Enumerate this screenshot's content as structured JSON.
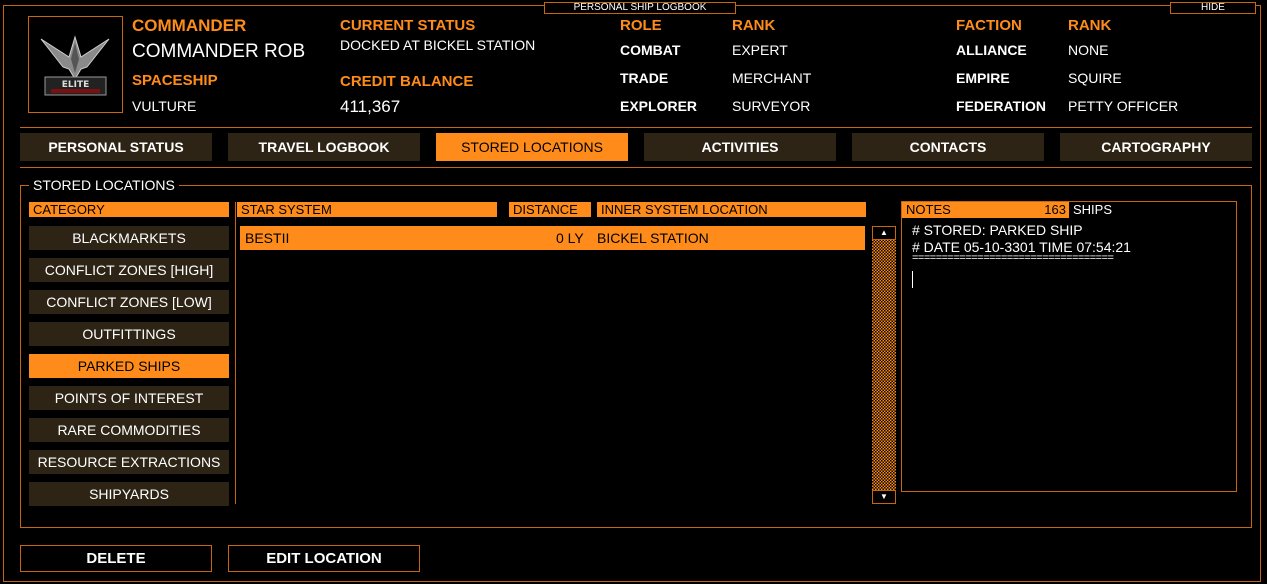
{
  "window": {
    "title": "PERSONAL SHIP LOGBOOK",
    "hide_label": "HIDE"
  },
  "commander": {
    "label": "COMMANDER",
    "name": "COMMANDER ROB",
    "ship_label": "SPACESHIP",
    "ship": "VULTURE",
    "status_label": "CURRENT STATUS",
    "status": "DOCKED AT BICKEL STATION",
    "credit_label": "CREDIT BALANCE",
    "credit": "411,367"
  },
  "roles": {
    "role_label": "ROLE",
    "rank_label": "RANK",
    "items": [
      {
        "role": "COMBAT",
        "rank": "EXPERT"
      },
      {
        "role": "TRADE",
        "rank": "MERCHANT"
      },
      {
        "role": "EXPLORER",
        "rank": "SURVEYOR"
      }
    ]
  },
  "factions": {
    "faction_label": "FACTION",
    "rank_label": "RANK",
    "items": [
      {
        "faction": "ALLIANCE",
        "rank": "NONE"
      },
      {
        "faction": "EMPIRE",
        "rank": "SQUIRE"
      },
      {
        "faction": "FEDERATION",
        "rank": "PETTY OFFICER"
      }
    ]
  },
  "tabs": [
    "PERSONAL STATUS",
    "TRAVEL LOGBOOK",
    "STORED LOCATIONS",
    "ACTIVITIES",
    "CONTACTS",
    "CARTOGRAPHY"
  ],
  "stored": {
    "group_title": "STORED LOCATIONS",
    "category_header": "CATEGORY",
    "categories": [
      "BLACKMARKETS",
      "CONFLICT ZONES [HIGH]",
      "CONFLICT ZONES [LOW]",
      "OUTFITTINGS",
      "PARKED SHIPS",
      "POINTS OF INTEREST",
      "RARE COMMODITIES",
      "RESOURCE EXTRACTIONS",
      "SHIPYARDS"
    ],
    "columns": {
      "system": "STAR SYSTEM",
      "distance": "DISTANCE",
      "location": "INNER SYSTEM LOCATION"
    },
    "rows": [
      {
        "system": "BESTII",
        "distance": "0 LY",
        "location": "BICKEL STATION"
      }
    ],
    "notes_label": "NOTES",
    "notes_count": "163",
    "notes_type": "SHIPS",
    "notes_lines": [
      "# STORED: PARKED SHIP",
      "# DATE 05-10-3301 TIME 07:54:21",
      "=================================="
    ]
  },
  "buttons": {
    "delete": "DELETE",
    "edit": "EDIT LOCATION"
  },
  "colors": {
    "accent": "#ff8c1a",
    "panel": "#2e2416",
    "border": "#c8660e"
  }
}
